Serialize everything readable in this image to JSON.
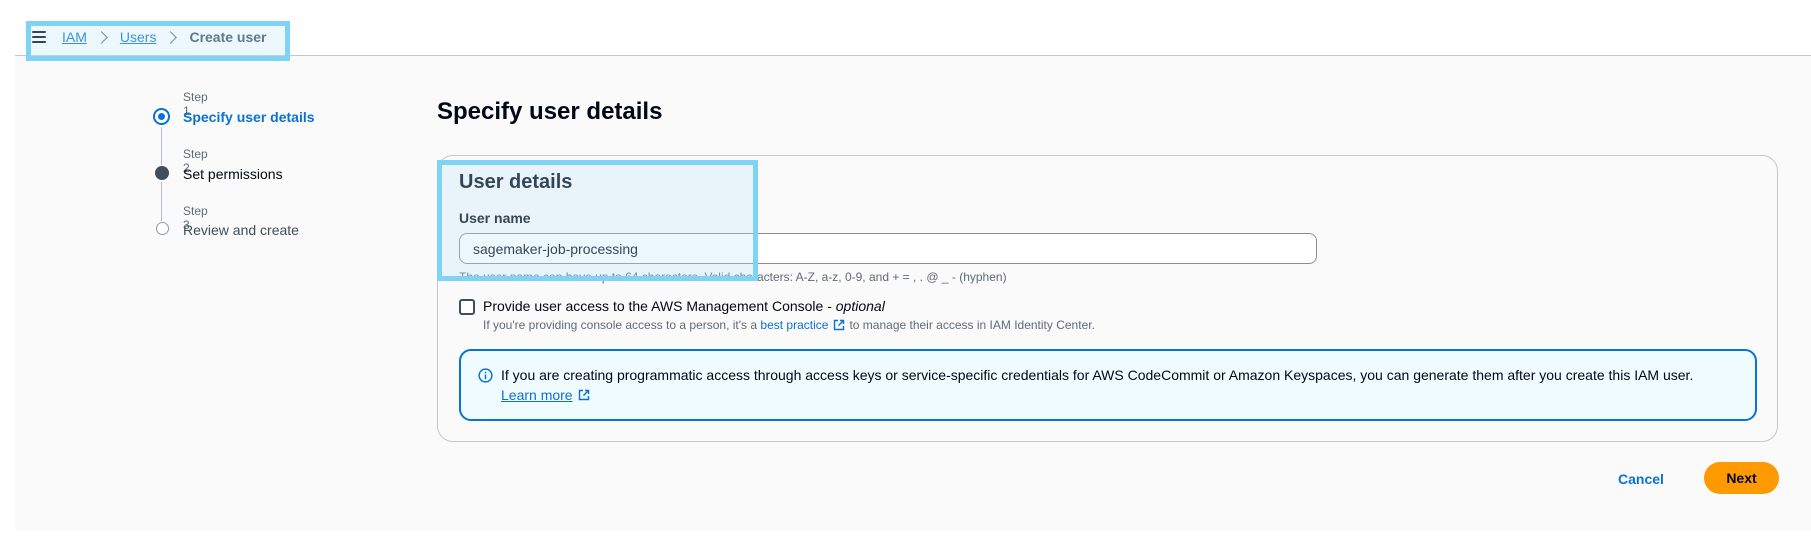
{
  "breadcrumb": {
    "menu_icon": "hamburger-menu-icon",
    "items": [
      "IAM",
      "Users"
    ],
    "current": "Create user"
  },
  "wizard": {
    "steps": [
      {
        "label": "Step 1",
        "title": "Specify user details",
        "state": "active"
      },
      {
        "label": "Step 2",
        "title": "Set permissions",
        "state": "completed"
      },
      {
        "label": "Step 3",
        "title": "Review and create",
        "state": "pending"
      }
    ]
  },
  "page": {
    "heading": "Specify user details"
  },
  "user_details": {
    "title": "User details",
    "username_label": "User name",
    "username_value": "sagemaker-job-processing",
    "constraint_text": "The user name can have up to 64 characters. Valid characters: A-Z, a-z, 0-9, and + = , . @ _ - (hyphen)",
    "console_access": {
      "label": "Provide user access to the AWS Management Console - ",
      "label_optional": "optional",
      "checked": false,
      "desc_before": "If you're providing console access to a person, it's a",
      "desc_link": "best practice",
      "desc_after": "to manage their access in IAM Identity Center."
    }
  },
  "alert": {
    "icon": "info-icon",
    "text": "If you are creating programmatic access through access keys or service-specific credentials for AWS CodeCommit or Amazon Keyspaces, you can generate them after you create this IAM user.",
    "link": "Learn more"
  },
  "actions": {
    "cancel": "Cancel",
    "next": "Next"
  },
  "colors": {
    "link": "#0972d3",
    "primary_button": "#ff9900",
    "highlight": "#7fd3f4"
  }
}
